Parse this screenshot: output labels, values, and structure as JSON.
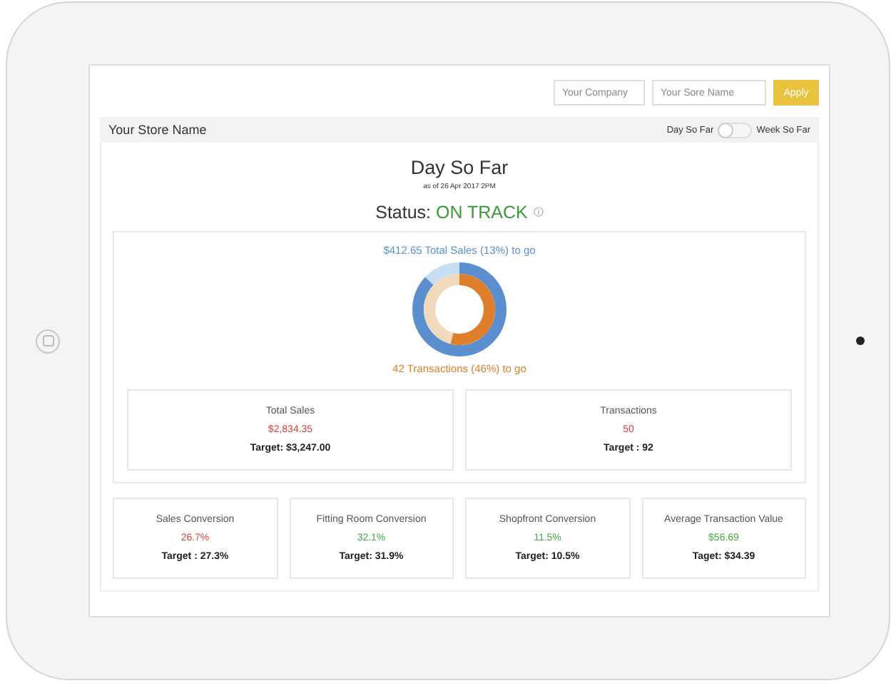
{
  "filters": {
    "company": {
      "placeholder": "Your Company"
    },
    "store": {
      "placeholder": "Your Sore Name"
    },
    "apply": "Apply"
  },
  "header": {
    "store_name": "Your Store Name",
    "toggle_left": "Day So Far",
    "toggle_right": "Week So Far",
    "toggle_on": false
  },
  "summary": {
    "title": "Day So Far",
    "as_of": "as of 26 Apr 2017 2PM",
    "status_label": "Status:",
    "status_value": "ON TRACK",
    "info_icon": "ⓘ"
  },
  "progress": {
    "sales_to_go": "$412.65 Total Sales (13%) to go",
    "transactions_to_go": "42 Transactions (46%) to go"
  },
  "main_metrics": [
    {
      "name": "Total Sales",
      "value": "$2,834.35",
      "color": "#d9423a",
      "target": "Target: $3,247.00"
    },
    {
      "name": "Transactions",
      "value": "50",
      "color": "#d9423a",
      "target": "Target : 92"
    }
  ],
  "metrics": [
    {
      "name": "Sales Conversion",
      "value": "26.7%",
      "color": "#d9423a",
      "target": "Target : 27.3%"
    },
    {
      "name": "Fitting Room Conversion",
      "value": "32.1%",
      "color": "#47a843",
      "target": "Target: 31.9%"
    },
    {
      "name": "Shopfront Conversion",
      "value": "11.5%",
      "color": "#47a843",
      "target": "Target: 10.5%"
    },
    {
      "name": "Average Transaction Value",
      "value": "$56.69",
      "color": "#47a843",
      "target": "Taget: $34.39"
    }
  ]
}
